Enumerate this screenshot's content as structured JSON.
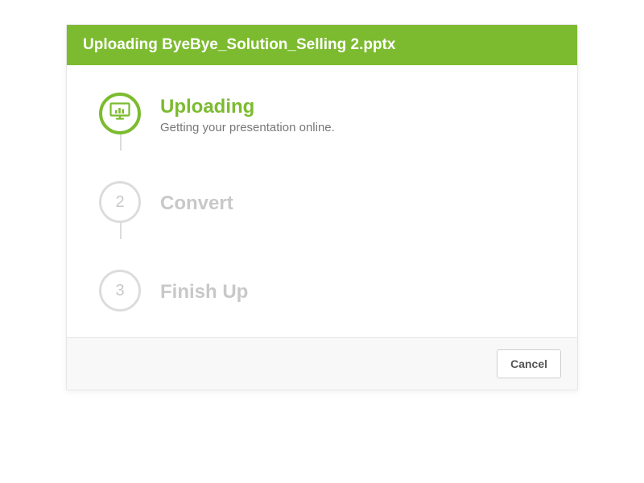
{
  "colors": {
    "accent": "#7cbb2f",
    "inactive": "#c8c8c8"
  },
  "header": {
    "title": "Uploading ByeBye_Solution_Selling 2.pptx"
  },
  "steps": [
    {
      "title": "Uploading",
      "subtitle": "Getting your presentation online.",
      "number": "",
      "active": true
    },
    {
      "title": "Convert",
      "subtitle": "",
      "number": "2",
      "active": false
    },
    {
      "title": "Finish Up",
      "subtitle": "",
      "number": "3",
      "active": false
    }
  ],
  "footer": {
    "cancel_label": "Cancel"
  }
}
